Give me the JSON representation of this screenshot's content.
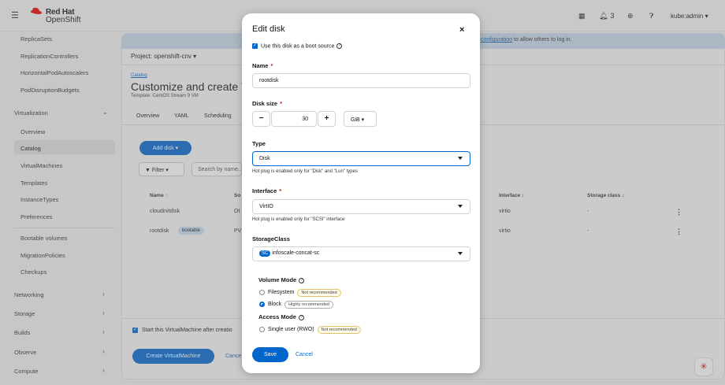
{
  "brand": {
    "line1": "Red Hat",
    "line2": "OpenShift"
  },
  "topbar": {
    "notifications_count": "3",
    "user": "kube:admin"
  },
  "sidebar": {
    "items_top": [
      "ReplicaSets",
      "ReplicationControllers",
      "HorizontalPodAutoscalers",
      "PodDisruptionBudgets"
    ],
    "virtualization": "Virtualization",
    "virt_items": [
      "Overview",
      "Catalog",
      "VirtualMachines",
      "Templates",
      "InstanceTypes",
      "Preferences"
    ],
    "virt_items2": [
      "Bootable volumes",
      "MigrationPolicies",
      "Checkups"
    ],
    "sections": [
      "Networking",
      "Storage",
      "Builds",
      "Observe",
      "Compute"
    ]
  },
  "banner": {
    "link": "configuration",
    "text": " to allow others to log in."
  },
  "main": {
    "project": "Project: openshift-cnv",
    "breadcrumb": "Catalog",
    "title": "Customize and create Vi",
    "template": "Template: CentOS Stream 9 VM",
    "tabs": [
      "Overview",
      "YAML",
      "Scheduling"
    ],
    "add_disk": "Add disk",
    "filter": "Filter",
    "search_placeholder": "Search by name...",
    "columns": {
      "name": "Name",
      "source": "So",
      "interface": "Interface",
      "storage_class": "Storage class"
    },
    "rows": [
      {
        "name": "cloudinitdisk",
        "source": "Ot",
        "interface": "virtio",
        "storage_class": "-"
      },
      {
        "name": "rootdisk",
        "badge": "bootable",
        "source": "PV",
        "interface": "virtio",
        "storage_class": "-"
      }
    ],
    "start_vm": "Start this VirtualMachine after creatio",
    "create_button": "Create VirtualMachine",
    "cancel": "Cance"
  },
  "modal": {
    "title": "Edit disk",
    "boot_source": "Use this disk as a boot source",
    "name_label": "Name",
    "name_value": "rootdisk",
    "disk_size_label": "Disk size",
    "disk_size_value": "30",
    "disk_unit": "GiB",
    "minus": "−",
    "plus": "+",
    "type_label": "Type",
    "type_value": "Disk",
    "type_help": "Hot plug is enabled only for \"Disk\" and \"Lun\" types",
    "interface_label": "Interface",
    "interface_value": "VirtIO",
    "interface_help": "Hot plug is enabled only for \"SCSI\" interface",
    "storageclass_label": "StorageClass",
    "sc_badge": "SC",
    "storageclass_value": "infoscale-concat-sc",
    "volume_mode_label": "Volume Mode",
    "filesystem": "Filesystem",
    "filesystem_badge": "Not recommended",
    "block": "Block",
    "block_badge": "Highly recommended",
    "access_mode_label": "Access Mode",
    "single_user": "Single user (RWO)",
    "single_user_badge": "Not recommended",
    "save": "Save",
    "cancel": "Cancel",
    "close": "×"
  },
  "colors": {
    "accent": "#0066cc",
    "brand_red": "#ee0000"
  }
}
